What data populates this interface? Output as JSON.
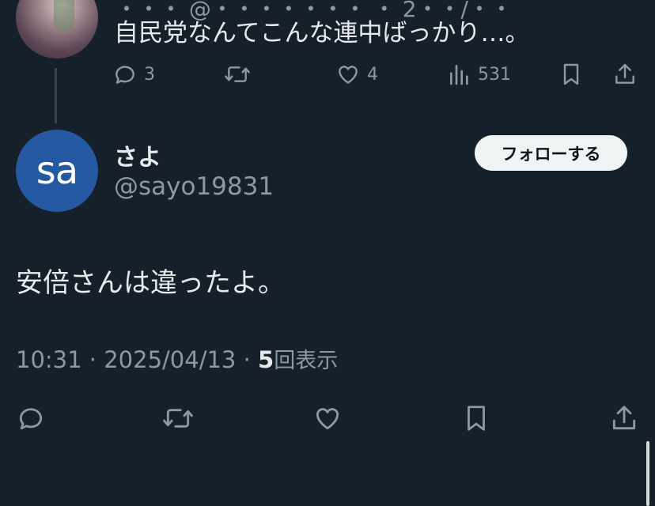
{
  "parent_tweet": {
    "handle_clipped": "・・・ @・・・・・・・ ・ 2・・/・・",
    "text": "自民党なんてこんな連中ばっかり…。",
    "reply_count": "3",
    "like_count": "4",
    "view_count": "531"
  },
  "tweet": {
    "avatar_initials": "sa",
    "display_name": "さよ",
    "handle": "@sayo19831",
    "follow_label": "フォローする",
    "text": "安倍さんは違ったよ。",
    "time": "10:31",
    "date": "2025/04/13",
    "separator": "·",
    "views_count": "5",
    "views_label": "回表示"
  },
  "icons": {
    "reply": "reply-icon",
    "repost": "repost-icon",
    "like": "like-icon",
    "views": "views-icon",
    "bookmark": "bookmark-icon",
    "share": "share-icon"
  },
  "colors": {
    "background": "#15202b",
    "text_primary": "#e7e9ea",
    "text_secondary": "#8b98a5",
    "avatar_bg": "#2458a0",
    "follow_button_bg": "#eff3f4"
  }
}
